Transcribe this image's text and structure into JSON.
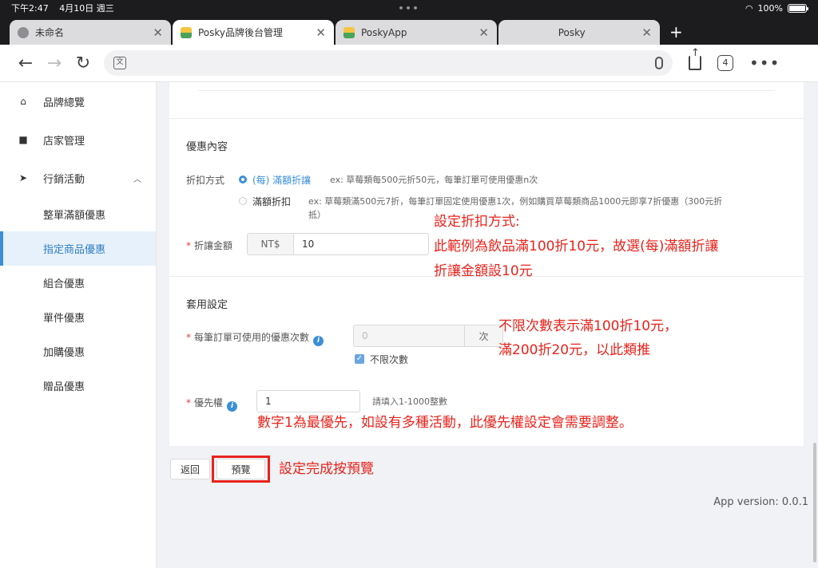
{
  "status": {
    "time": "下午2:47",
    "date": "4月10日 週三",
    "battery": "100%",
    "battery_level": 1.0
  },
  "tabs": [
    {
      "title": "未命名",
      "icon": "globe-icon"
    },
    {
      "title": "Posky品牌後台管理",
      "icon": "posky-icon",
      "active": true
    },
    {
      "title": "PoskyApp",
      "icon": "posky-icon"
    },
    {
      "title": "Posky",
      "icon": "none"
    }
  ],
  "toolbar": {
    "tab_count": "4"
  },
  "sidebar": {
    "items": [
      {
        "label": "品牌總覽",
        "icon": "home-icon"
      },
      {
        "label": "店家管理",
        "icon": "store-icon"
      },
      {
        "label": "行銷活動",
        "icon": "send-icon",
        "expanded": true
      }
    ],
    "sub_items": [
      {
        "label": "整單滿額優惠"
      },
      {
        "label": "指定商品優惠",
        "selected": true
      },
      {
        "label": "組合優惠"
      },
      {
        "label": "單件優惠"
      },
      {
        "label": "加購優惠"
      },
      {
        "label": "贈品優惠"
      }
    ]
  },
  "discount": {
    "section_title": "優惠內容",
    "method_label": "折扣方式",
    "option1_label": "(每) 滿額折讓",
    "option1_hint": "ex: 草莓類每500元折50元，每筆訂單可使用優惠n次",
    "option2_label": "滿額折扣",
    "option2_hint_line1": "ex: 草莓類滿500元7折，每筆訂單固定使用優惠1次，例如購買草莓類商品1000元即享7折優惠（300元折",
    "option2_hint_line2": "抵）",
    "amount_label": "折讓金額",
    "amount_prefix": "NT$",
    "amount_value": "10"
  },
  "apply": {
    "section_title": "套用設定",
    "usage_label": "每筆訂單可使用的優惠次數",
    "usage_placeholder": "0",
    "usage_suffix": "次",
    "unlimited_label": "不限次數",
    "unlimited_checked": true,
    "priority_label": "優先權",
    "priority_value": "1",
    "priority_hint": "請填入1-1000整數"
  },
  "annotations": {
    "a1_line1": "設定折扣方式:",
    "a1_line2": "此範例為飲品滿100折10元，故選(每)滿額折讓",
    "a1_line3": "折讓金額設10元",
    "a2_line1": "不限次數表示滿100折10元，",
    "a2_line2": "滿200折20元，以此類推",
    "a3": "數字1為最優先，如設有多種活動，此優先權設定會需要調整。",
    "a4": "設定完成按預覽"
  },
  "footer": {
    "back_label": "返回",
    "preview_label": "預覽",
    "version": "App version: 0.0.1"
  },
  "colors": {
    "accent": "#3b8fd6",
    "annotation": "#e8231c"
  }
}
